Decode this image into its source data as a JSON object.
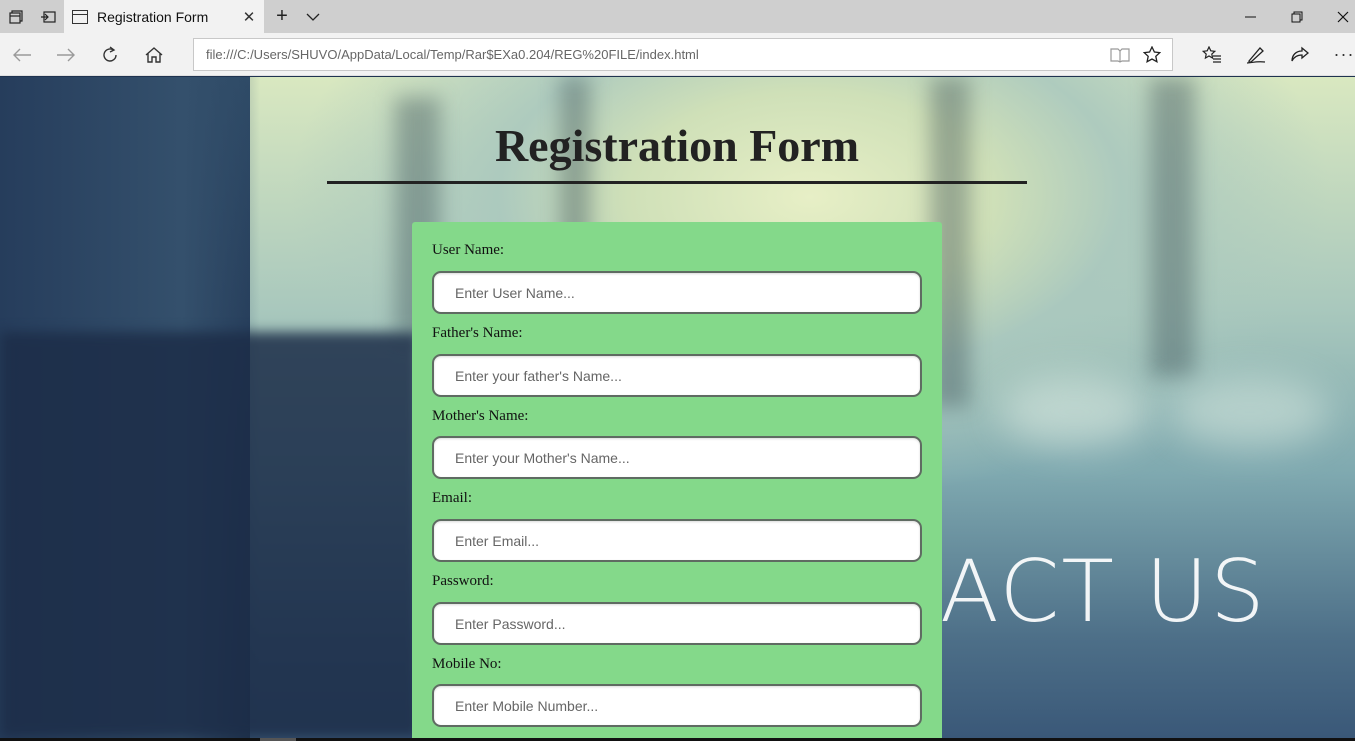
{
  "browser": {
    "tab_title": "Registration Form",
    "tab_close": "✕",
    "new_tab": "+",
    "tab_list": "⌵",
    "address": "file:///C:/Users/SHUVO/AppData/Local/Temp/Rar$EXa0.204/REG%20FILE/index.html",
    "icons": [
      "tab-groups-icon",
      "set-aside-tabs-icon",
      "back-icon",
      "forward-icon",
      "refresh-icon",
      "home-icon",
      "reading-view-icon",
      "favorite-star-icon",
      "favorites-list-icon",
      "pen-icon",
      "share-icon",
      "more-icon",
      "minimize-icon",
      "restore-icon",
      "close-window-icon"
    ]
  },
  "page": {
    "heading": "Registration Form",
    "background_text": "ACT US",
    "form_bg": "#84d98a",
    "fields": [
      {
        "label": "User Name:",
        "placeholder": "Enter User Name..."
      },
      {
        "label": "Father's Name:",
        "placeholder": "Enter your father's Name..."
      },
      {
        "label": "Mother's Name:",
        "placeholder": "Enter your Mother's Name..."
      },
      {
        "label": "Email:",
        "placeholder": "Enter Email..."
      },
      {
        "label": "Password:",
        "placeholder": "Enter Password..."
      },
      {
        "label": "Mobile No:",
        "placeholder": "Enter Mobile Number..."
      }
    ]
  }
}
